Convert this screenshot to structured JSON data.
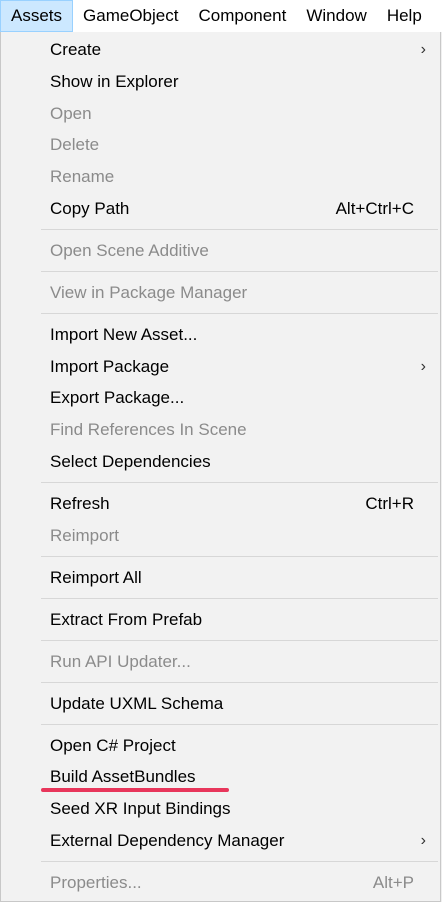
{
  "menubar": {
    "items": [
      "Assets",
      "GameObject",
      "Component",
      "Window",
      "Help"
    ],
    "active": "Assets"
  },
  "menu": {
    "items": [
      {
        "label": "Create",
        "enabled": true,
        "submenu": true
      },
      {
        "label": "Show in Explorer",
        "enabled": true
      },
      {
        "label": "Open",
        "enabled": false
      },
      {
        "label": "Delete",
        "enabled": false
      },
      {
        "label": "Rename",
        "enabled": false
      },
      {
        "label": "Copy Path",
        "enabled": true,
        "shortcut": "Alt+Ctrl+C"
      },
      {
        "label": "Open Scene Additive",
        "enabled": false
      },
      {
        "label": "View in Package Manager",
        "enabled": false
      },
      {
        "label": "Import New Asset...",
        "enabled": true
      },
      {
        "label": "Import Package",
        "enabled": true,
        "submenu": true
      },
      {
        "label": "Export Package...",
        "enabled": true
      },
      {
        "label": "Find References In Scene",
        "enabled": false
      },
      {
        "label": "Select Dependencies",
        "enabled": true
      },
      {
        "label": "Refresh",
        "enabled": true,
        "shortcut": "Ctrl+R"
      },
      {
        "label": "Reimport",
        "enabled": false
      },
      {
        "label": "Reimport All",
        "enabled": true
      },
      {
        "label": "Extract From Prefab",
        "enabled": true
      },
      {
        "label": "Run API Updater...",
        "enabled": false
      },
      {
        "label": "Update UXML Schema",
        "enabled": true
      },
      {
        "label": "Open C# Project",
        "enabled": true
      },
      {
        "label": "Build AssetBundles",
        "enabled": true,
        "highlighted": true
      },
      {
        "label": "Seed XR Input Bindings",
        "enabled": true
      },
      {
        "label": "External Dependency Manager",
        "enabled": true,
        "submenu": true
      },
      {
        "label": "Properties...",
        "enabled": false,
        "shortcut": "Alt+P"
      }
    ],
    "submenu_arrow": "›",
    "highlight_color": "#e8365b"
  }
}
